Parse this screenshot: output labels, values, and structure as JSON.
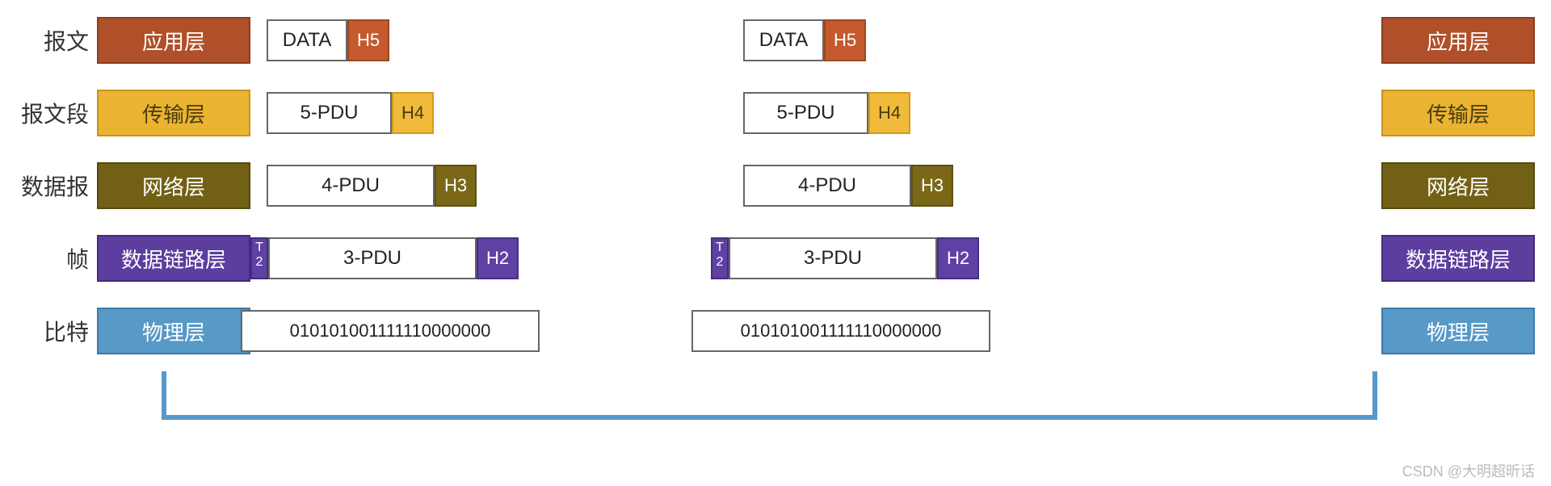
{
  "labels": {
    "message": "报文",
    "segment": "报文段",
    "datagram": "数据报",
    "frame": "帧",
    "bit": "比特"
  },
  "layers": {
    "application": "应用层",
    "transport": "传输层",
    "network": "网络层",
    "datalink": "数据链路层",
    "physical": "物理层"
  },
  "pdu": {
    "app_data": "DATA",
    "app_header": "H5",
    "trans_data": "5-PDU",
    "trans_header": "H4",
    "net_data": "4-PDU",
    "net_header": "H3",
    "link_trailer": "T\n2",
    "link_data": "3-PDU",
    "link_header": "H2",
    "bits": "010101001111110000000"
  },
  "watermark": "CSDN @大明超昕话"
}
